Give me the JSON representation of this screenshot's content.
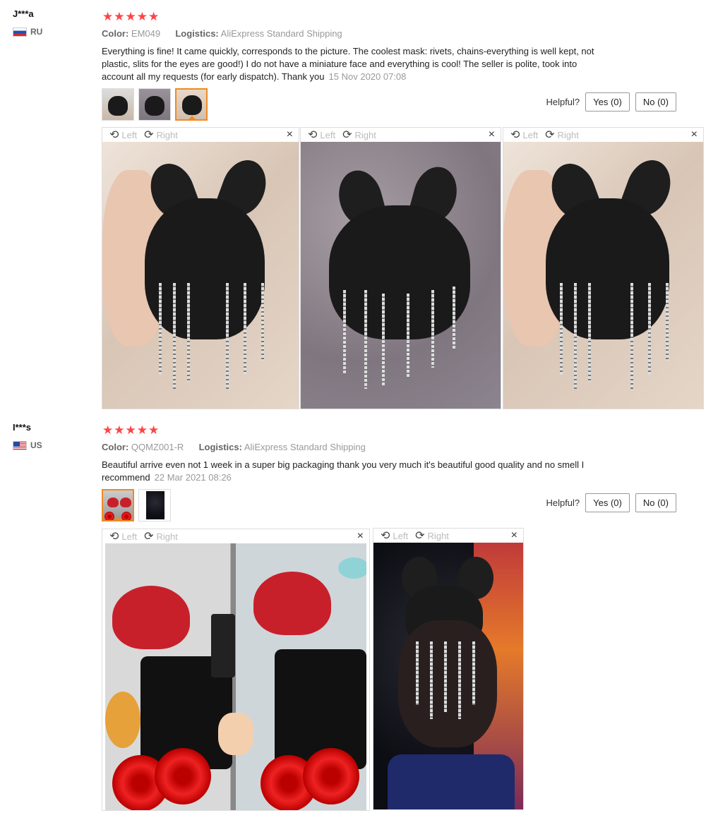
{
  "reviews": [
    {
      "user": "J***a",
      "country": "RU",
      "stars": "★★★★★",
      "color_label": "Color:",
      "color_value": "EM049",
      "logistics_label": "Logistics:",
      "logistics_value": "AliExpress Standard Shipping",
      "text": "Everything is fine! It came quickly, corresponds to the picture. The coolest mask: rivets, chains-everything is well kept, not plastic, slits for the eyes are good!) I do not have a miniature face and everything is cool! The seller is polite, took into account all my requests (for early dispatch). Thank you",
      "date": "15 Nov 2020 07:08",
      "helpful_label": "Helpful?",
      "yes_label": "Yes (0)",
      "no_label": "No (0)",
      "viewer_left": "Left",
      "viewer_right": "Right",
      "close_glyph": "×",
      "rotate_left_glyph": "⟲",
      "rotate_right_glyph": "⟳"
    },
    {
      "user": "I***s",
      "country": "US",
      "stars": "★★★★★",
      "color_label": "Color:",
      "color_value": "QQMZ001-R",
      "logistics_label": "Logistics:",
      "logistics_value": "AliExpress Standard Shipping",
      "text": "Beautiful arrive even not 1 week in a super big packaging thank you very much it's beautiful good quality and no smell I recommend",
      "date": "22 Mar 2021 08:26",
      "helpful_label": "Helpful?",
      "yes_label": "Yes (0)",
      "no_label": "No (0)",
      "viewer_left": "Left",
      "viewer_right": "Right",
      "close_glyph": "×",
      "rotate_left_glyph": "⟲",
      "rotate_right_glyph": "⟳"
    }
  ],
  "colors": {
    "stars": "#ff4444",
    "active_thumb": "#f08a24",
    "muted_text": "#999999"
  },
  "icons": [
    "star-icon",
    "flag-ru-icon",
    "flag-us-icon",
    "rotate-left-icon",
    "rotate-right-icon",
    "close-icon"
  ]
}
